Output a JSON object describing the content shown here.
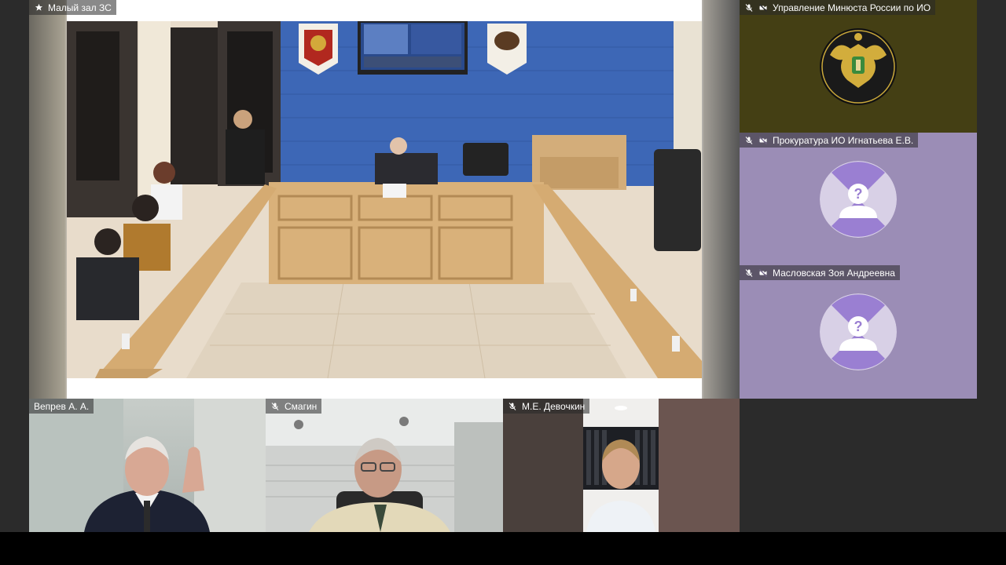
{
  "tiles": {
    "main": {
      "name": "Малый зал ЗС",
      "icon": "star-icon"
    },
    "minjust": {
      "name": "Управление Минюста России по ИО",
      "icons": [
        "mic-muted-icon",
        "camera-off-icon"
      ]
    },
    "prokuratura": {
      "name": "Прокуратура ИО Игнатьева Е.В.",
      "icons": [
        "mic-muted-icon",
        "camera-off-icon"
      ]
    },
    "maslovskaya": {
      "name": "Масловская Зоя Андреевна",
      "icons": [
        "mic-muted-icon",
        "camera-off-icon"
      ]
    },
    "veprev": {
      "name": "Вепрев А. А."
    },
    "smagin": {
      "name": "Смагин",
      "icons": [
        "mic-muted-icon"
      ]
    },
    "devochkin": {
      "name": "М.Е. Девочкин",
      "icons": [
        "mic-muted-icon"
      ]
    }
  },
  "placeholder_glyph": "?",
  "colors": {
    "minjust_bg": "#443f14",
    "avatar_tile_bg": "#9b8db6",
    "avatar_dark": "#9a7fd2",
    "avatar_light": "#d8d0e6",
    "wall_blue": "#3d67b6",
    "wood": "#d9b17a"
  }
}
